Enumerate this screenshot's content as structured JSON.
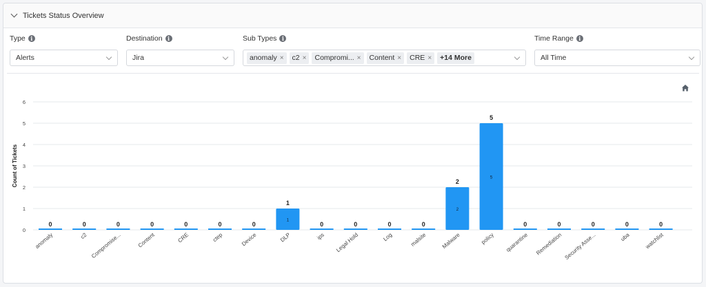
{
  "panel": {
    "title": "Tickets Status Overview"
  },
  "filters": {
    "type": {
      "label": "Type",
      "value": "Alerts"
    },
    "destination": {
      "label": "Destination",
      "value": "Jira"
    },
    "sub_types": {
      "label": "Sub Types",
      "tags": [
        "anomaly",
        "c2",
        "Compromi...",
        "Content",
        "CRE"
      ],
      "more": "+14 More"
    },
    "time_range": {
      "label": "Time Range",
      "value": "All Time"
    }
  },
  "icons": {
    "home": "home-icon",
    "info": "info-icon",
    "collapse": "chevron-down-icon"
  },
  "colors": {
    "bar": "#2196f3",
    "text": "#333333"
  },
  "chart_data": {
    "type": "bar",
    "title": "",
    "xlabel": "",
    "ylabel": "Count of Tickets",
    "ylim": [
      0,
      6
    ],
    "yticks": [
      0,
      1,
      2,
      3,
      4,
      5,
      6
    ],
    "grid": true,
    "categories": [
      "anomaly",
      "c2",
      "Compromise...",
      "Content",
      "CRE",
      "ctep",
      "Device",
      "DLP",
      "ips",
      "Legal Hold",
      "Log",
      "malsite",
      "Malware",
      "policy",
      "quarantine",
      "Remediation",
      "Security Asse...",
      "uba",
      "watchlist"
    ],
    "values": [
      0,
      0,
      0,
      0,
      0,
      0,
      0,
      1,
      0,
      0,
      0,
      0,
      2,
      5,
      0,
      0,
      0,
      0,
      0
    ]
  }
}
